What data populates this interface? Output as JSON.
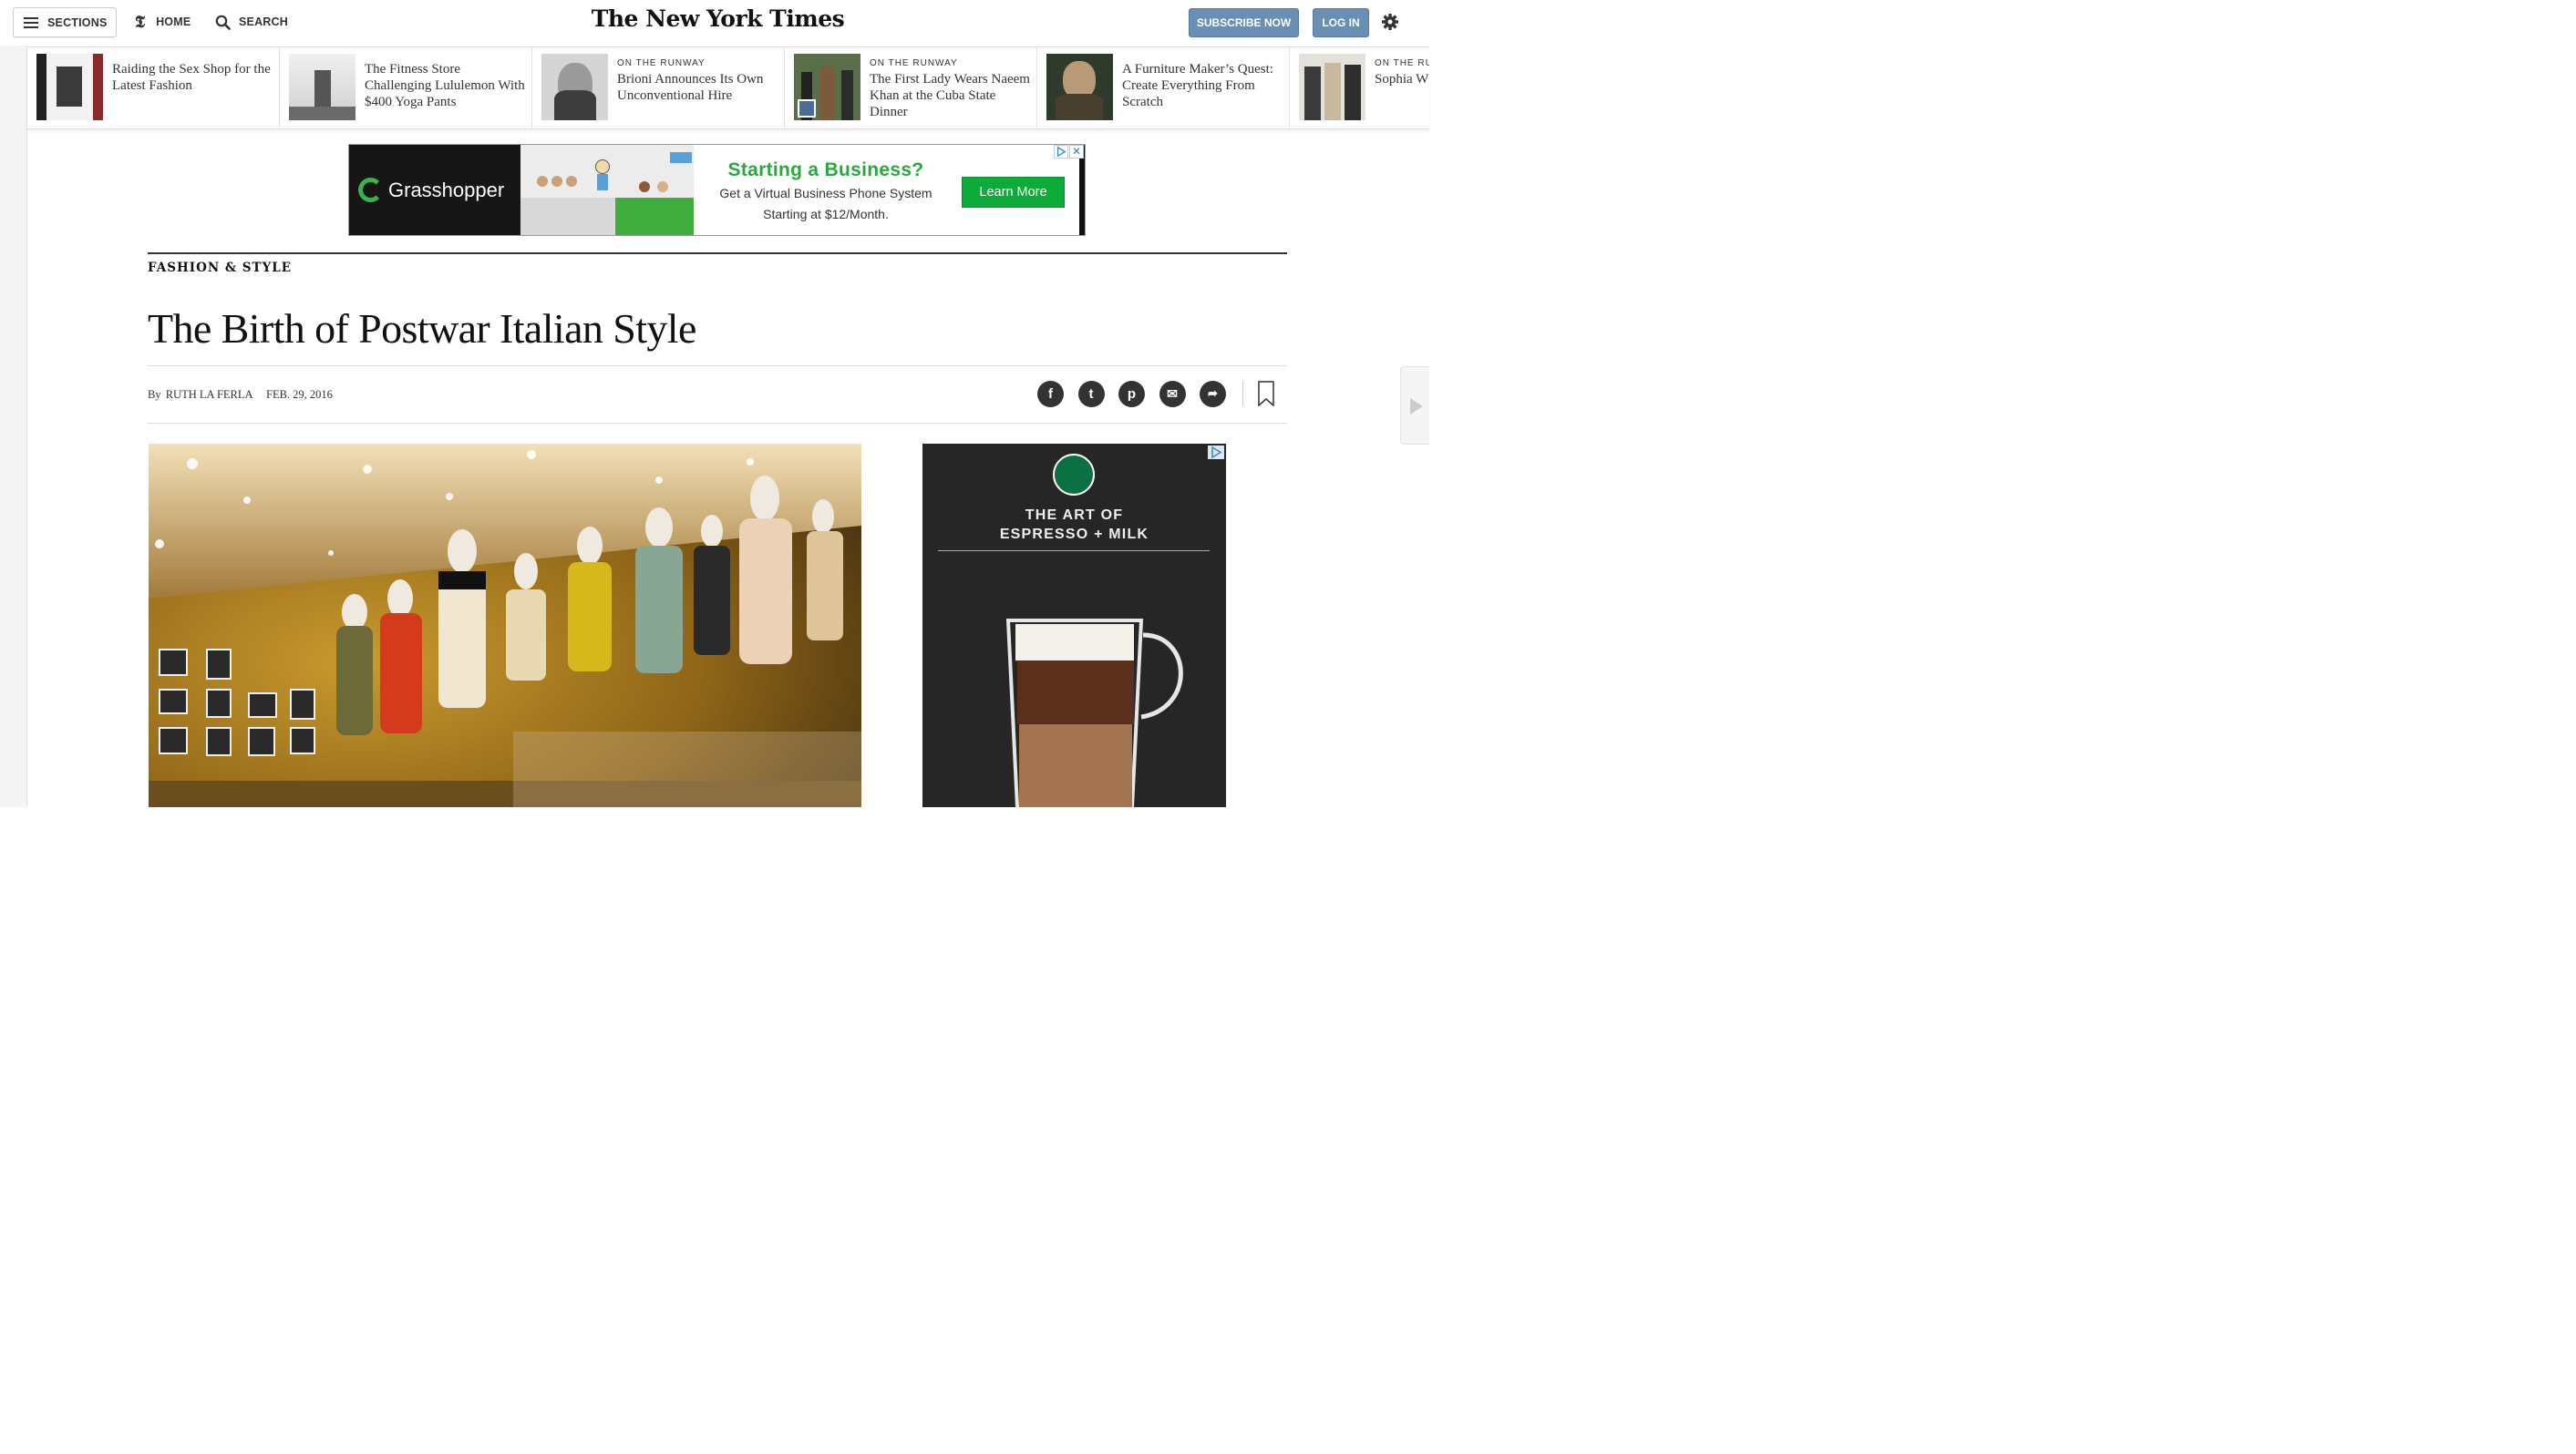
{
  "masthead": {
    "sections_label": "SECTIONS",
    "home_label": "HOME",
    "search_label": "SEARCH",
    "logo": "The New York Times",
    "subscribe_label": "SUBSCRIBE NOW",
    "login_label": "LOG IN"
  },
  "ribbon": [
    {
      "kicker": "",
      "headline": "Raiding the Sex Shop for the Latest Fashion"
    },
    {
      "kicker": "",
      "headline": "The Fitness Store Challenging Lululemon With $400 Yoga Pants"
    },
    {
      "kicker": "ON THE RUNWAY",
      "headline": "Brioni Announces Its Own Unconventional Hire"
    },
    {
      "kicker": "ON THE RUNWAY",
      "headline": "The First Lady Wears Naeem Khan at the Cuba State Dinner"
    },
    {
      "kicker": "",
      "headline": "A Furniture Maker’s Quest: Create Everything From Scratch"
    },
    {
      "kicker": "ON THE RUN",
      "headline": "Sophia W British Fa"
    }
  ],
  "top_ad": {
    "brand": "Grasshopper",
    "title": "Starting a Business?",
    "line1": "Get a Virtual Business Phone System",
    "line2": "Starting at $12/Month.",
    "cta": "Learn More",
    "close": "✕"
  },
  "article": {
    "section": "FASHION & STYLE",
    "title": "The Birth of Postwar Italian Style",
    "by": "By",
    "author": "RUTH LA FERLA",
    "date": "FEB. 29, 2016"
  },
  "share": {
    "facebook": "f",
    "twitter": "t",
    "pinterest": "p",
    "email": "✉",
    "more": "➦"
  },
  "side_ad": {
    "line1": "THE ART OF",
    "line2": "ESPRESSO + MILK"
  },
  "colors": {
    "accent_blue": "#6a8fb4",
    "grasshopper_green": "#2aa83e",
    "starbucks_green": "#0b7043"
  }
}
